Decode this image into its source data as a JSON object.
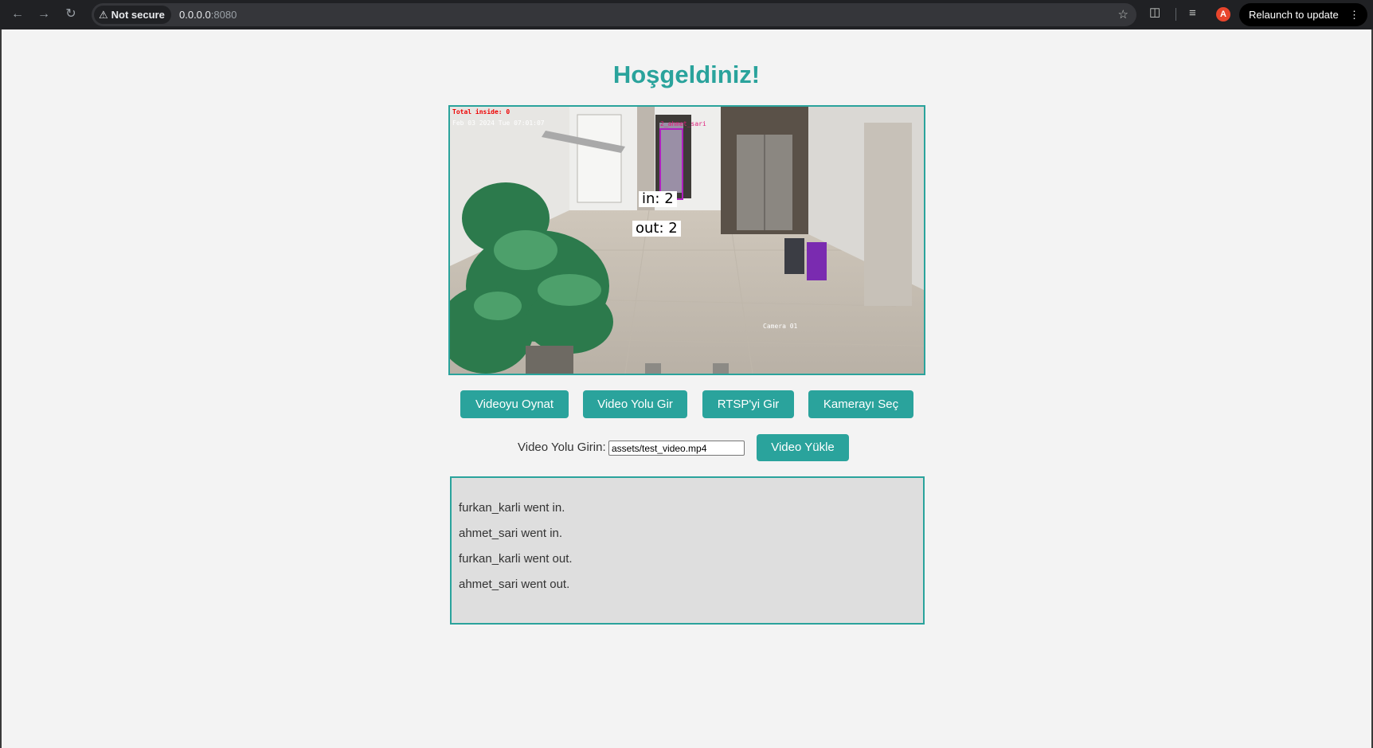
{
  "browser": {
    "security_label": "Not secure",
    "url_host": "0.0.0.0",
    "url_port": ":8080",
    "relaunch_label": "Relaunch to update",
    "avatar_letter": "A"
  },
  "page": {
    "title": "Hoşgeldiniz!"
  },
  "video": {
    "overlay_in": "in: 2",
    "overlay_out": "out: 2",
    "osd_camera": "Camera 01"
  },
  "controls": {
    "play_label": "Videoyu Oynat",
    "video_path_label": "Video Yolu Gir",
    "rtsp_label": "RTSP'yi Gir",
    "camera_label": "Kamerayı Seç"
  },
  "video_input": {
    "label": "Video Yolu Girin:",
    "value": "assets/test_video.mp4",
    "load_label": "Video Yükle"
  },
  "log": {
    "entries": [
      "furkan_karli went in.",
      "ahmet_sari went in.",
      "furkan_karli went out.",
      "ahmet_sari went out."
    ]
  },
  "colors": {
    "accent": "#2aa39c",
    "background": "#f3f3f3",
    "log_background": "#dedede"
  }
}
